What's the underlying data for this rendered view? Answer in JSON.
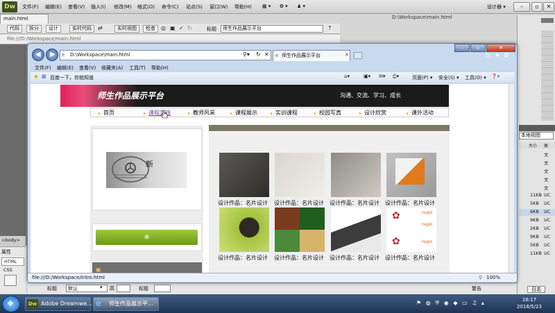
{
  "dw": {
    "logo": "Dw",
    "menus": [
      "文件(F)",
      "编辑(E)",
      "查看(V)",
      "插入(I)",
      "修改(M)",
      "格式(O)",
      "命令(C)",
      "站点(S)",
      "窗口(W)",
      "帮助(H)"
    ],
    "designer": "设计器 ▾",
    "doc_tab": "main.html",
    "doc_path": "D:\\Workspace\\main.html",
    "path_bar": "file:///D:/Workspace/main.html",
    "toolbar": {
      "code": "代码",
      "split": "拆分",
      "design": "设计",
      "live_code": "实时代码",
      "live_view": "实时视图",
      "inspect": "检查",
      "title_label": "标题",
      "title_value": "师生作品展示平台"
    },
    "files_panel": {
      "view_select": "本地视图",
      "col_size": "大小",
      "col_type": "类",
      "rows": [
        [
          "",
          "文"
        ],
        [
          "",
          "文"
        ],
        [
          "",
          "文"
        ],
        [
          "",
          "文"
        ],
        [
          "",
          "文"
        ],
        [
          "11KB",
          "UC"
        ],
        [
          "5KB",
          "UC"
        ],
        [
          "6KB",
          "UC"
        ],
        [
          "9KB",
          "UC"
        ],
        [
          "2KB",
          "UC"
        ],
        [
          "9KB",
          "UC"
        ],
        [
          "5KB",
          "UC"
        ],
        [
          "11KB",
          "UC"
        ]
      ]
    },
    "left_panel": {
      "body": "<body>",
      "props": "属性",
      "html": "HTML",
      "css": "CSS"
    },
    "bottom_props": {
      "head_label": "标题",
      "head_value": "默认",
      "height_label": "高",
      "title_label": "标题"
    },
    "log_button": "日志",
    "ready": "警告"
  },
  "ie": {
    "address": "D:\\Workspace\\main.html",
    "tab_title": "师生作品展示平台",
    "menu": [
      "文件(F)",
      "编辑(E)",
      "查看(V)",
      "收藏夹(A)",
      "工具(T)",
      "帮助(H)"
    ],
    "favorites_bar": "百度一下，你就知道",
    "cmd": {
      "page": "页面(P) ▾",
      "safety": "安全(S) ▾",
      "tools": "工具(O) ▾"
    },
    "status_url": "file:///D:/Workspace/intro.html",
    "zoom": "100%"
  },
  "site": {
    "title": "师生作品展示平台",
    "slogan": "沟通、交流、学习、成长",
    "nav": [
      "首页",
      "课程实践",
      "教师风采",
      "课程展示",
      "实训课程",
      "校园写真",
      "设计欣赏",
      "课外活动"
    ],
    "photo_text": "新",
    "works_caption": "设计作品：名片设计"
  },
  "taskbar": {
    "apps": [
      "Adobe Dreamwe...",
      "师生作品展示平..."
    ],
    "time": "16:17",
    "date": "2018/5/23"
  },
  "colors": {
    "banner_pink": "#e0235a",
    "nav_arrow": "#d9a21b",
    "green_button": "#8ab828",
    "taskbar": "#2c4569"
  }
}
